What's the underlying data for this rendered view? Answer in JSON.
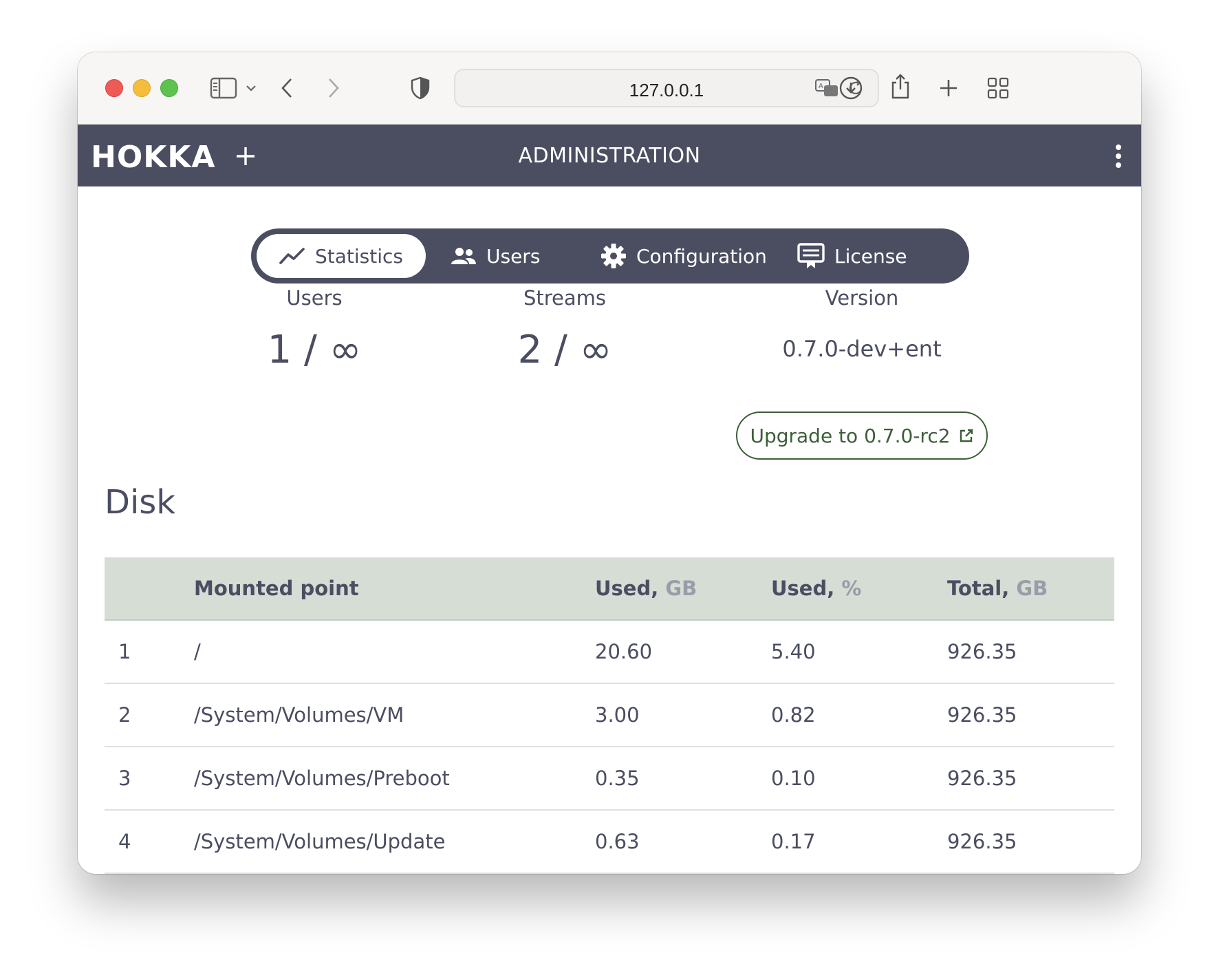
{
  "browser": {
    "url": "127.0.0.1"
  },
  "app": {
    "logo": "HOKKA",
    "title": "ADMINISTRATION"
  },
  "tabs": [
    {
      "label": "Statistics",
      "icon": "chart-line-icon",
      "active": true
    },
    {
      "label": "Users",
      "icon": "users-icon",
      "active": false
    },
    {
      "label": "Configuration",
      "icon": "gear-icon",
      "active": false
    },
    {
      "label": "License",
      "icon": "license-icon",
      "active": false
    }
  ],
  "stats": {
    "users": {
      "label": "Users",
      "value": "1 / ∞"
    },
    "streams": {
      "label": "Streams",
      "value": "2 / ∞"
    },
    "version": {
      "label": "Version",
      "value": "0.7.0-dev+ent",
      "upgrade_label": "Upgrade to 0.7.0-rc2"
    }
  },
  "disk": {
    "title": "Disk",
    "columns": {
      "mounted": "Mounted point",
      "used": "Used,",
      "used_unit": "GB",
      "used_pct": "Used,",
      "used_pct_unit": "%",
      "total": "Total,",
      "total_unit": "GB"
    },
    "rows": [
      {
        "index": "1",
        "mount": "/",
        "used": "20.60",
        "pct": "5.40",
        "total": "926.35"
      },
      {
        "index": "2",
        "mount": "/System/Volumes/VM",
        "used": "3.00",
        "pct": "0.82",
        "total": "926.35"
      },
      {
        "index": "3",
        "mount": "/System/Volumes/Preboot",
        "used": "0.35",
        "pct": "0.10",
        "total": "926.35"
      },
      {
        "index": "4",
        "mount": "/System/Volumes/Update",
        "used": "0.63",
        "pct": "0.17",
        "total": "926.35"
      }
    ]
  },
  "colors": {
    "header_bg": "#4b4d61",
    "table_header_bg": "#d5ddd5",
    "upgrade_accent": "#3d5e38"
  }
}
